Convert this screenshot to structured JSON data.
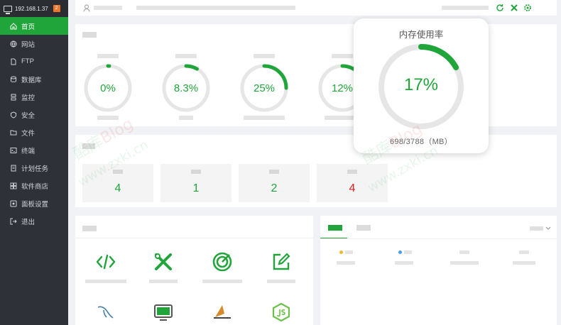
{
  "sidebar": {
    "ip": "192.168.1.37",
    "badge": "2",
    "items": [
      {
        "label": "首页",
        "icon": "home-icon",
        "active": true
      },
      {
        "label": "网站",
        "icon": "globe-icon"
      },
      {
        "label": "FTP",
        "icon": "ftp-icon"
      },
      {
        "label": "数据库",
        "icon": "database-icon"
      },
      {
        "label": "监控",
        "icon": "monitor-icon"
      },
      {
        "label": "安全",
        "icon": "shield-icon"
      },
      {
        "label": "文件",
        "icon": "folder-icon"
      },
      {
        "label": "终端",
        "icon": "terminal-icon"
      },
      {
        "label": "计划任务",
        "icon": "task-icon"
      },
      {
        "label": "软件商店",
        "icon": "store-icon"
      },
      {
        "label": "面板设置",
        "icon": "settings-icon"
      },
      {
        "label": "退出",
        "icon": "logout-icon"
      }
    ]
  },
  "status": {
    "gauges": [
      {
        "value": "0%",
        "fraction": 0.01
      },
      {
        "value": "8.3%",
        "fraction": 0.083
      },
      {
        "value": "25%",
        "fraction": 0.25
      },
      {
        "value": "12%",
        "fraction": 0.12
      }
    ]
  },
  "overview": {
    "stats": [
      {
        "value": "4",
        "color": "#20a53a"
      },
      {
        "value": "1",
        "color": "#20a53a"
      },
      {
        "value": "2",
        "color": "#20a53a"
      },
      {
        "value": "4",
        "color": "#e02020"
      }
    ]
  },
  "memory_popup": {
    "title": "内存使用率",
    "value": "17%",
    "fraction": 0.17,
    "detail": "698/3788（MB）"
  },
  "software": {
    "icons": [
      "code-icon",
      "tools-icon",
      "target-icon",
      "edit-icon",
      "mysql-icon",
      "remote-desktop-icon",
      "tomcat-icon",
      "nodejs-icon"
    ]
  },
  "watermarks": [
    {
      "prefix": "酷库",
      "brand": "Blog"
    },
    {
      "text": "www.zxki.cn"
    },
    {
      "prefix": "酷库",
      "brand": "Blog"
    },
    {
      "text": "www.zxki.cn"
    }
  ],
  "colors": {
    "accent": "#20a53a",
    "danger": "#e02020",
    "sidebar": "#2e3238"
  }
}
